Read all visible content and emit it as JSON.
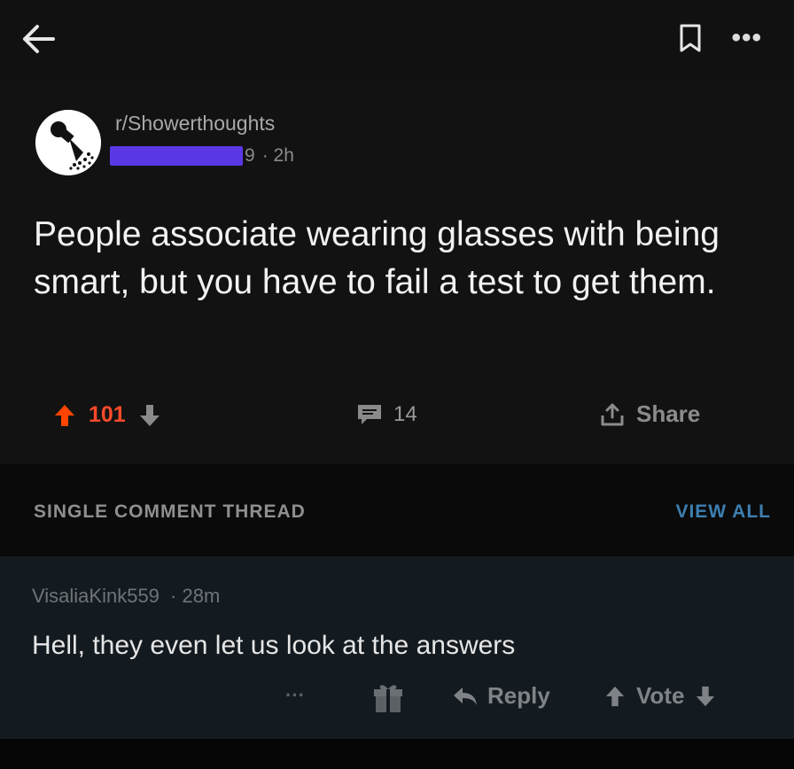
{
  "header": {
    "back_icon": "arrow-left-icon",
    "bookmark_icon": "bookmark-icon",
    "more_label": "•••"
  },
  "post": {
    "subreddit": "r/Showerthoughts",
    "author_suffix": "9",
    "time": "· 2h",
    "title": "People associate wearing glasses with being smart, but you have to fail a test to get them.",
    "score": "101",
    "comment_count": "14",
    "share_label": "Share",
    "upvote_color": "#ff4500",
    "avatar_icon": "shower-head-icon"
  },
  "thread": {
    "label": "SINGLE COMMENT THREAD",
    "view_all": "VIEW ALL",
    "accent": "#3d7fb0"
  },
  "comment": {
    "author": "VisaliaKink559",
    "time": "· 28m",
    "body": "Hell, they even let us look at the answers",
    "more_label": "···",
    "reply_label": "Reply",
    "vote_label": "Vote"
  }
}
